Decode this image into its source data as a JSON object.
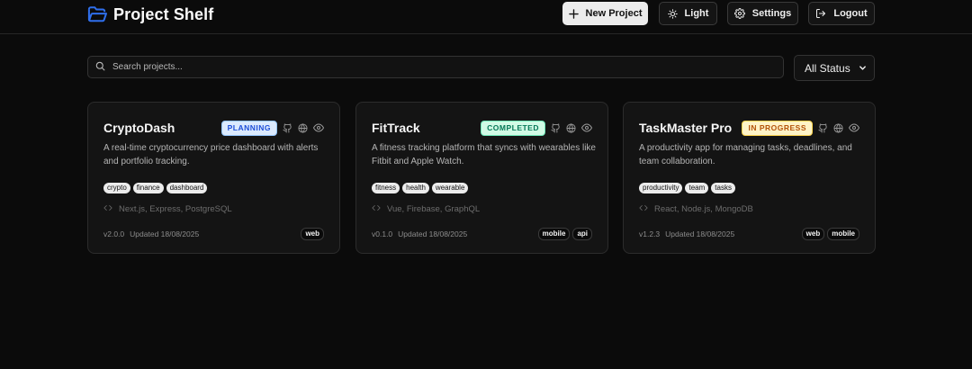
{
  "app": {
    "title": "Project Shelf",
    "brand_color": "#2f6fec"
  },
  "header": {
    "new_project_label": "New Project",
    "theme_label": "Light",
    "settings_label": "Settings",
    "logout_label": "Logout"
  },
  "search": {
    "placeholder": "Search projects...",
    "value": ""
  },
  "filter": {
    "selected": "All Status"
  },
  "projects": [
    {
      "name": "CryptoDash",
      "status": "PLANNING",
      "status_colors": {
        "bg": "#dbeafe",
        "fg": "#1d4ed8",
        "border": "#93c5fd"
      },
      "description": "A real-time cryptocurrency price dashboard with alerts and portfolio tracking.",
      "tags": [
        "crypto",
        "finance",
        "dashboard"
      ],
      "stack": "Next.js, Express, PostgreSQL",
      "version": "v2.0.0",
      "updated": "Updated 18/08/2025",
      "platforms": [
        "web"
      ]
    },
    {
      "name": "FitTrack",
      "status": "COMPLETED",
      "status_colors": {
        "bg": "#d1fae5",
        "fg": "#047857",
        "border": "#6ee7b7"
      },
      "description": "A fitness tracking platform that syncs with wearables like Fitbit and Apple Watch.",
      "tags": [
        "fitness",
        "health",
        "wearable"
      ],
      "stack": "Vue, Firebase, GraphQL",
      "version": "v0.1.0",
      "updated": "Updated 18/08/2025",
      "platforms": [
        "mobile",
        "api"
      ]
    },
    {
      "name": "TaskMaster Pro",
      "status": "IN PROGRESS",
      "status_colors": {
        "bg": "#fef3c7",
        "fg": "#b45309",
        "border": "#fcd34d"
      },
      "description": "A productivity app for managing tasks, deadlines, and team collaboration.",
      "tags": [
        "productivity",
        "team",
        "tasks"
      ],
      "stack": "React, Node.js, MongoDB",
      "version": "v1.2.3",
      "updated": "Updated 18/08/2025",
      "platforms": [
        "web",
        "mobile"
      ]
    }
  ]
}
